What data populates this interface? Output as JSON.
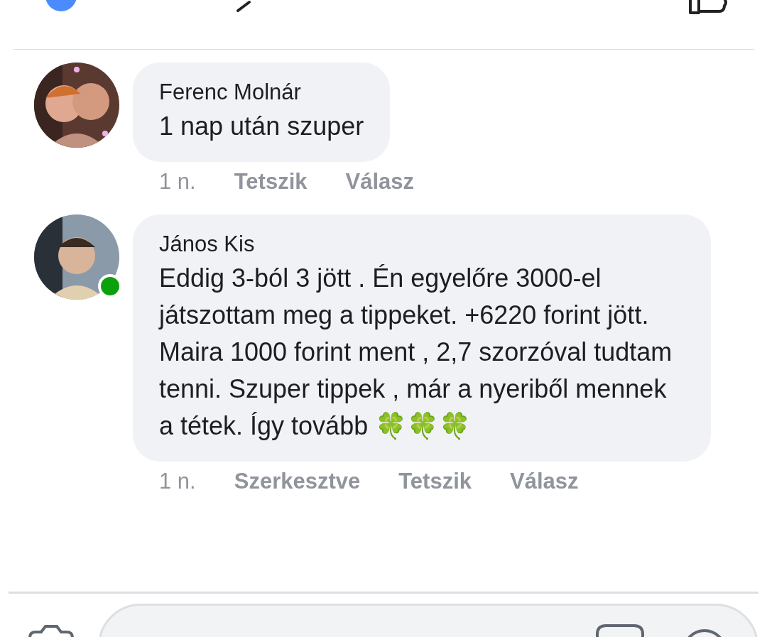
{
  "comments": [
    {
      "author": "Ferenc Molnár",
      "text": "1 nap után szuper",
      "online": false,
      "actions": [
        {
          "kind": "time",
          "label": "1 n."
        },
        {
          "kind": "action",
          "label": "Tetszik"
        },
        {
          "kind": "action",
          "label": "Válasz"
        }
      ]
    },
    {
      "author": "János Kis",
      "text": "Eddig 3-ból 3 jött . Én egyelőre 3000-el játszottam meg a tippeket. +6220 forint jött. Maira 1000 forint ment , 2,7 szorzóval tudtam tenni. Szuper tippek , már a nyeriből mennek a tétek. Így tovább 🍀🍀🍀",
      "online": true,
      "actions": [
        {
          "kind": "time",
          "label": "1 n."
        },
        {
          "kind": "status",
          "label": "Szerkesztve"
        },
        {
          "kind": "action",
          "label": "Tetszik"
        },
        {
          "kind": "action",
          "label": "Válasz"
        }
      ]
    }
  ]
}
